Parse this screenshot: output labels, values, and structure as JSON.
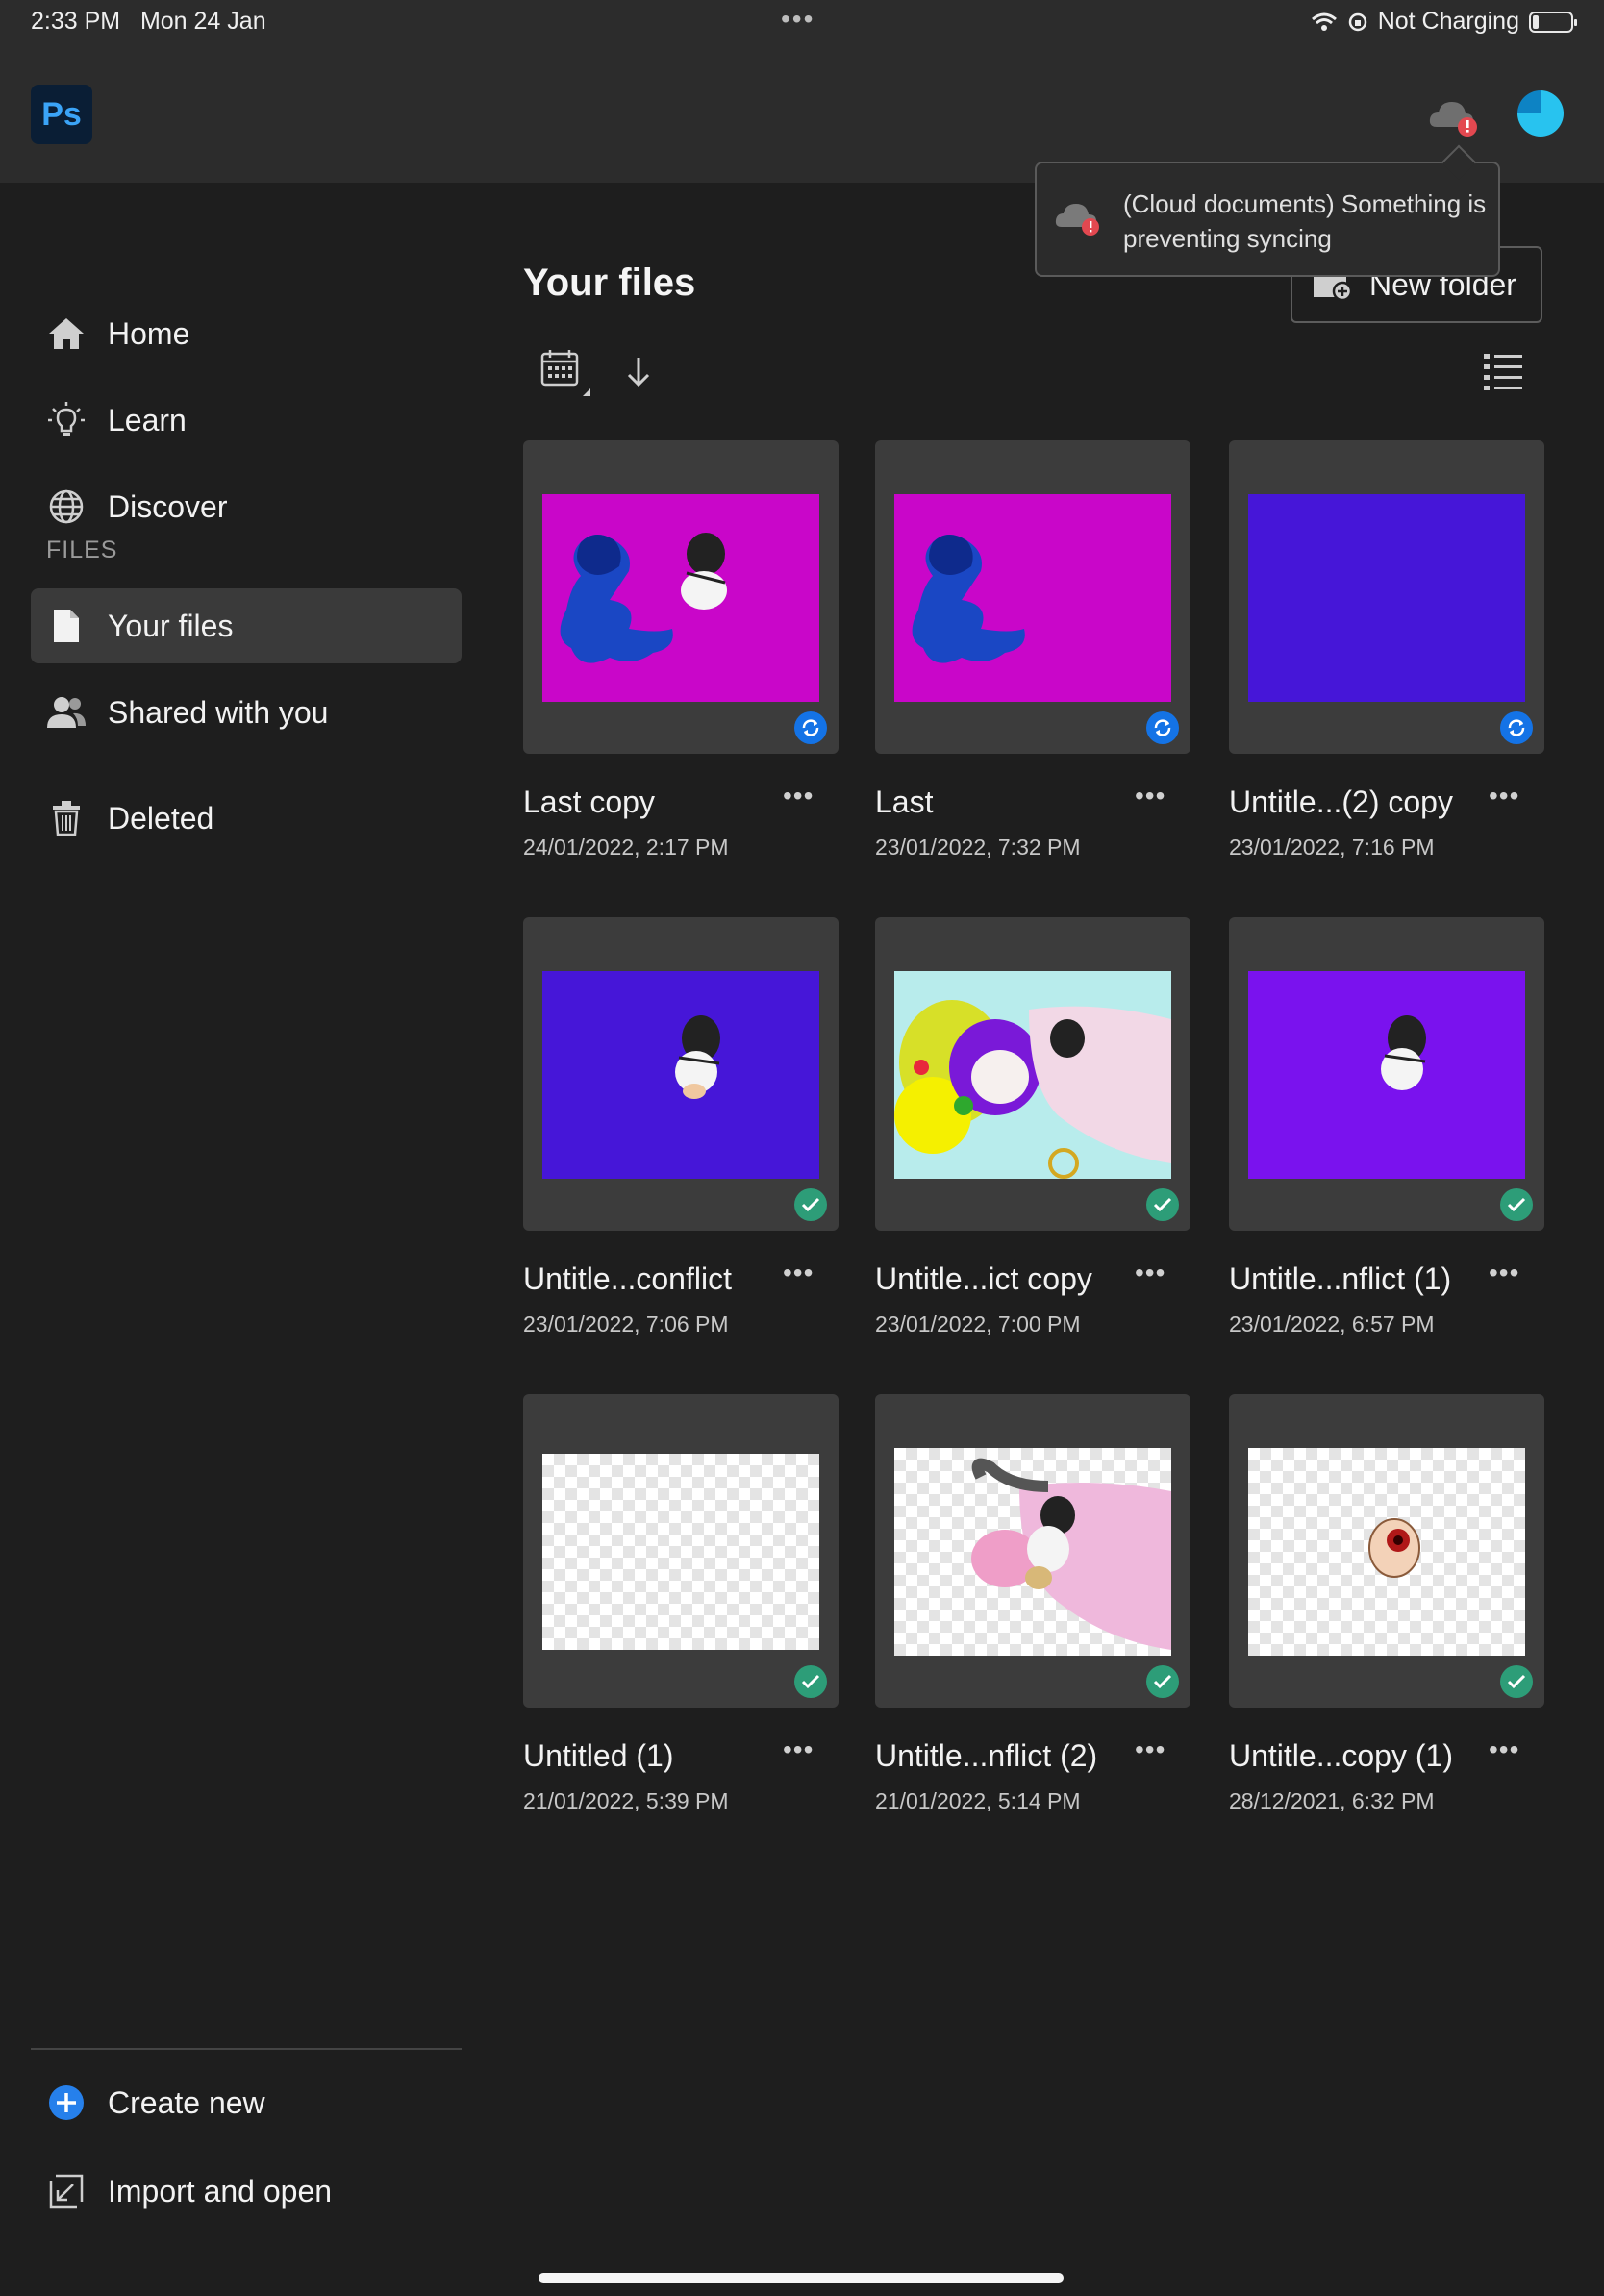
{
  "status_bar": {
    "time": "2:33 PM",
    "date": "Mon 24 Jan",
    "charging": "Not Charging",
    "battery_level_fraction": 0.15
  },
  "app_bar": {
    "logo": "Ps"
  },
  "tooltip": {
    "text": "(Cloud documents) Something is preventing syncing"
  },
  "sidebar": {
    "nav": [
      {
        "label": "Home",
        "icon": "home-icon"
      },
      {
        "label": "Learn",
        "icon": "lightbulb-icon"
      },
      {
        "label": "Discover",
        "icon": "globe-icon"
      }
    ],
    "files_section": "FILES",
    "files_nav": [
      {
        "label": "Your files",
        "icon": "document-icon",
        "active": true
      },
      {
        "label": "Shared with you",
        "icon": "people-icon"
      },
      {
        "label": "Deleted",
        "icon": "trash-icon"
      }
    ],
    "bottom": [
      {
        "label": "Create new",
        "icon": "add-circle-icon"
      },
      {
        "label": "Import and open",
        "icon": "import-icon"
      }
    ]
  },
  "main": {
    "title": "Your files",
    "new_folder_label": "New folder",
    "files": [
      {
        "name": "Last copy",
        "date": "24/01/2022, 2:17 PM",
        "status": "syncing",
        "thumb": "magenta-art"
      },
      {
        "name": "Last",
        "date": "23/01/2022, 7:32 PM",
        "status": "syncing",
        "thumb": "magenta-art-2"
      },
      {
        "name": "Untitle...(2) copy",
        "date": "23/01/2022, 7:16 PM",
        "status": "syncing",
        "thumb": "blue-plain"
      },
      {
        "name": "Untitle...conflict",
        "date": "23/01/2022, 7:06 PM",
        "status": "synced",
        "thumb": "blue-figure"
      },
      {
        "name": "Untitle...ict copy",
        "date": "23/01/2022, 7:00 PM",
        "status": "synced",
        "thumb": "colorful-scene"
      },
      {
        "name": "Untitle...nflict (1)",
        "date": "23/01/2022, 6:57 PM",
        "status": "synced",
        "thumb": "purple-figure"
      },
      {
        "name": "Untitled (1)",
        "date": "21/01/2022, 5:39 PM",
        "status": "synced",
        "thumb": "transparent"
      },
      {
        "name": "Untitle...nflict (2)",
        "date": "21/01/2022, 5:14 PM",
        "status": "synced",
        "thumb": "transparent-scene"
      },
      {
        "name": "Untitle...copy (1)",
        "date": "28/12/2021, 6:32 PM",
        "status": "synced",
        "thumb": "transparent-eye"
      }
    ]
  },
  "colors": {
    "background": "#1e1e1e",
    "bar": "#2c2c2c",
    "card": "#3c3c3c",
    "sync_blue": "#1473e6",
    "synced_green": "#2d9d78",
    "alert_red": "#e34850"
  }
}
